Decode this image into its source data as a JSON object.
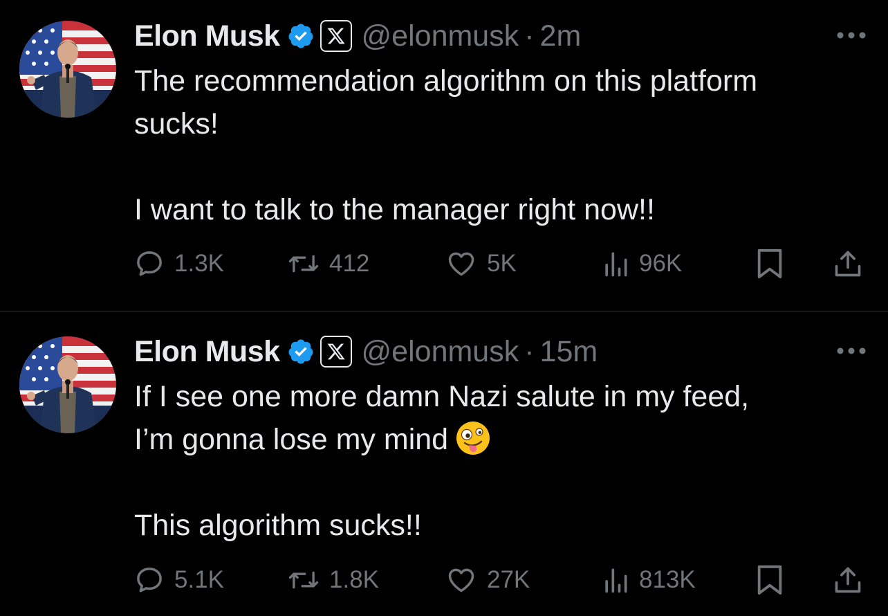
{
  "tweets": [
    {
      "author": {
        "name": "Elon Musk",
        "handle": "@elonmusk",
        "verified": true,
        "affiliate_badge": "x-logo-icon"
      },
      "time": "2m",
      "body": [
        "The recommendation algorithm on this platform",
        "sucks!",
        "I want to talk to the manager right now!!"
      ],
      "stats": {
        "replies": "1.3K",
        "reposts": "412",
        "likes": "5K",
        "views": "96K"
      }
    },
    {
      "author": {
        "name": "Elon Musk",
        "handle": "@elonmusk",
        "verified": true,
        "affiliate_badge": "x-logo-icon"
      },
      "time": "15m",
      "body": [
        "If I see one more damn Nazi salute in my feed,",
        "I’m gonna lose my mind",
        "This algorithm sucks!!"
      ],
      "emoji": "zany-face-emoji",
      "stats": {
        "replies": "5.1K",
        "reposts": "1.8K",
        "likes": "27K",
        "views": "813K"
      }
    }
  ],
  "separator": "·",
  "colors": {
    "background": "#000000",
    "text": "#e7e9ea",
    "muted": "#71767b",
    "verified": "#1d9bf0",
    "divider": "#2f3336"
  }
}
